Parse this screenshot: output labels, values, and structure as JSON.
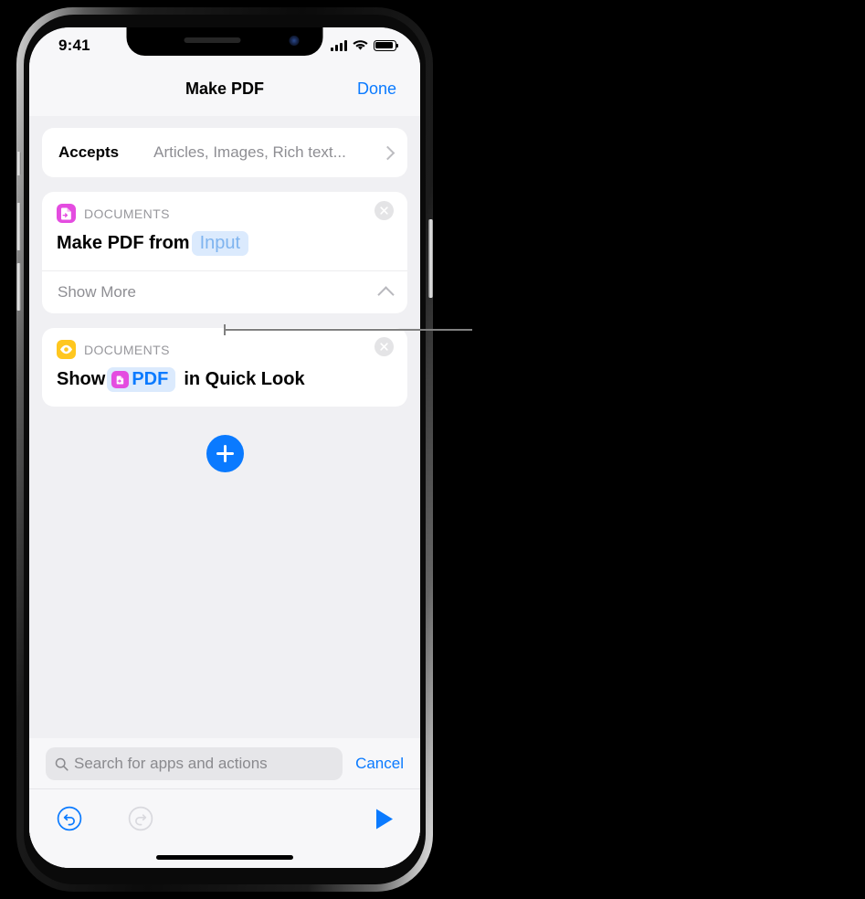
{
  "status_bar": {
    "time": "9:41",
    "signal_icon": "cellular-bars-icon",
    "wifi_icon": "wifi-icon",
    "battery_icon": "battery-full-icon"
  },
  "nav_bar": {
    "title": "Make PDF",
    "done_label": "Done"
  },
  "accepts_row": {
    "label": "Accepts",
    "value": "Articles, Images, Rich text...",
    "chevron_icon": "chevron-right-icon"
  },
  "actions": [
    {
      "category": "DOCUMENTS",
      "app_icon": "make-pdf-icon",
      "app_icon_color": "#e44ce0",
      "remove_icon": "close-circle-icon",
      "text_before": "Make PDF from",
      "token": "Input",
      "text_after": "",
      "show_more_label": "Show More",
      "show_more_chevron": "chevron-up-icon"
    },
    {
      "category": "DOCUMENTS",
      "app_icon": "quick-look-eye-icon",
      "app_icon_color": "#ffc71f",
      "remove_icon": "close-circle-icon",
      "text_before": "Show",
      "token": "PDF",
      "token_icon": "pdf-variable-icon",
      "text_after": "in Quick Look"
    }
  ],
  "add_button": {
    "icon": "plus-icon",
    "color": "#0a7aff"
  },
  "search": {
    "placeholder": "Search for apps and actions",
    "icon": "search-icon",
    "cancel_label": "Cancel"
  },
  "toolbar": {
    "undo_icon": "undo-icon",
    "redo_icon": "redo-icon",
    "run_icon": "play-icon",
    "accent_color": "#0a7aff",
    "disabled_color": "#d3d3d8"
  },
  "callout": {
    "line_color": "#808080"
  }
}
